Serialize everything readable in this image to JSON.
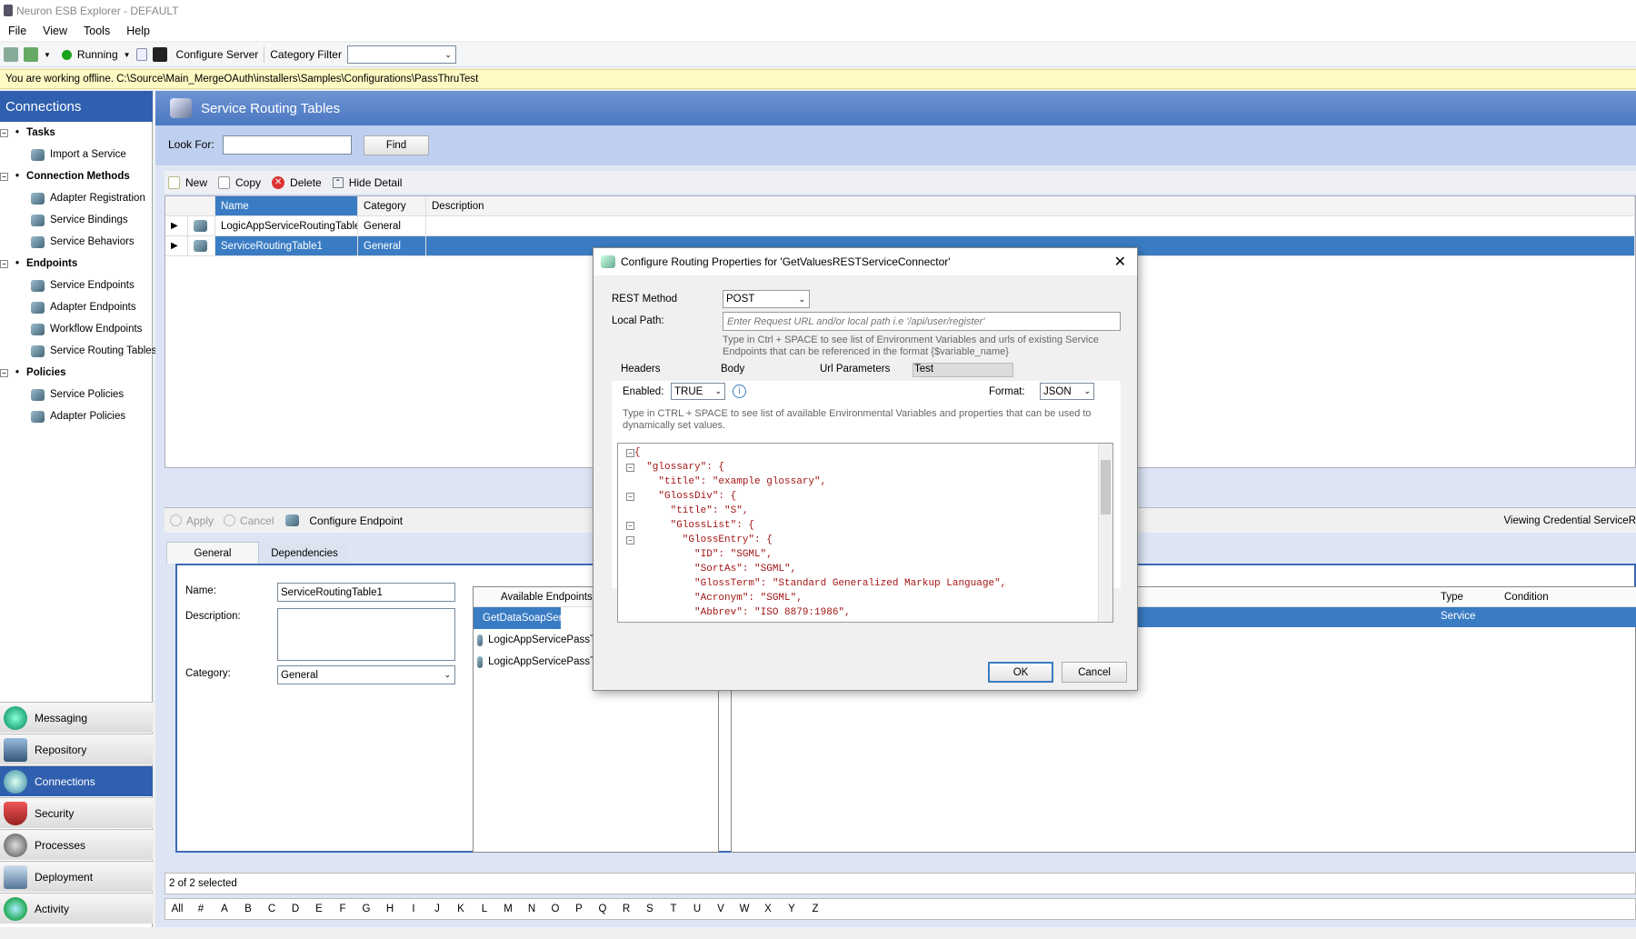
{
  "window": {
    "title": "Neuron ESB Explorer - DEFAULT"
  },
  "menu": [
    "File",
    "View",
    "Tools",
    "Help"
  ],
  "toolbar": {
    "status": "Running",
    "configure_server": "Configure Server",
    "category_filter_label": "Category Filter",
    "category_filter_value": ""
  },
  "infobar": {
    "text": "You are working offline. C:\\Source\\Main_MergeOAuth\\installers\\Samples\\Configurations\\PassThruTest"
  },
  "sidebar": {
    "title": "Connections",
    "groups": [
      {
        "label": "Tasks",
        "items": [
          "Import a Service"
        ]
      },
      {
        "label": "Connection Methods",
        "items": [
          "Adapter Registration",
          "Service Bindings",
          "Service Behaviors"
        ]
      },
      {
        "label": "Endpoints",
        "items": [
          "Service Endpoints",
          "Adapter Endpoints",
          "Workflow Endpoints",
          "Service Routing Tables"
        ]
      },
      {
        "label": "Policies",
        "items": [
          "Service Policies",
          "Adapter Policies"
        ]
      }
    ],
    "nav": [
      "Messaging",
      "Repository",
      "Connections",
      "Security",
      "Processes",
      "Deployment",
      "Activity"
    ],
    "active_nav": "Connections"
  },
  "main": {
    "title": "Service Routing Tables",
    "look_for_label": "Look For:",
    "look_for_value": "",
    "find_label": "Find",
    "grid_toolbar": {
      "new": "New",
      "copy": "Copy",
      "delete": "Delete",
      "hide_detail": "Hide Detail"
    },
    "columns": [
      "Name",
      "Category",
      "Description"
    ],
    "rows": [
      {
        "name": "LogicAppServiceRoutingTable",
        "category": "General",
        "description": ""
      },
      {
        "name": "ServiceRoutingTable1",
        "category": "General",
        "description": ""
      }
    ],
    "selected_row": 1
  },
  "detail": {
    "apply": "Apply",
    "cancel": "Cancel",
    "configure_endpoint": "Configure Endpoint",
    "viewing_text": "Viewing Credential ServiceR",
    "tabs": [
      "General",
      "Dependencies"
    ],
    "name_label": "Name:",
    "name_value": "ServiceRoutingTable1",
    "description_label": "Description:",
    "description_value": "",
    "category_label": "Category:",
    "category_value": "General",
    "available_endpoints_header": "Available Endpoints",
    "available_endpoints": [
      "GetDataSoapService",
      "LogicAppServicePassT",
      "LogicAppServicePassT"
    ],
    "right_columns": [
      "Type",
      "Condition"
    ],
    "right_row_type": "Service"
  },
  "status": {
    "selected": "2 of 2 selected"
  },
  "alphabet": [
    "All",
    "#",
    "A",
    "B",
    "C",
    "D",
    "E",
    "F",
    "G",
    "H",
    "I",
    "J",
    "K",
    "L",
    "M",
    "N",
    "O",
    "P",
    "Q",
    "R",
    "S",
    "T",
    "U",
    "V",
    "W",
    "X",
    "Y",
    "Z"
  ],
  "dialog": {
    "title": "Configure Routing Properties for 'GetValuesRESTServiceConnector'",
    "rest_method_label": "REST Method",
    "rest_method_value": "POST",
    "local_path_label": "Local Path:",
    "local_path_placeholder": "Enter Request URL and/or local path i.e '/api/user/register'",
    "local_path_hint": "Type in Ctrl + SPACE to see list of Environment Variables and urls of existing Service Endpoints that can be referenced in the format {$variable_name}",
    "tabs": [
      "Headers",
      "Body",
      "Url Parameters",
      "Test"
    ],
    "enabled_label": "Enabled:",
    "enabled_value": "TRUE",
    "format_label": "Format:",
    "format_value": "JSON",
    "body_hint": "Type in CTRL + SPACE to see list of available Environmental Variables and properties that can be used to dynamically set values.",
    "json_lines": [
      "{",
      "  \"glossary\": {",
      "    \"title\": \"example glossary\",",
      "    \"GlossDiv\": {",
      "      \"title\": \"S\",",
      "      \"GlossList\": {",
      "        \"GlossEntry\": {",
      "          \"ID\": \"SGML\",",
      "          \"SortAs\": \"SGML\",",
      "          \"GlossTerm\": \"Standard Generalized Markup Language\",",
      "          \"Acronym\": \"SGML\",",
      "          \"Abbrev\": \"ISO 8879:1986\","
    ],
    "ok": "OK",
    "cancel": "Cancel"
  }
}
